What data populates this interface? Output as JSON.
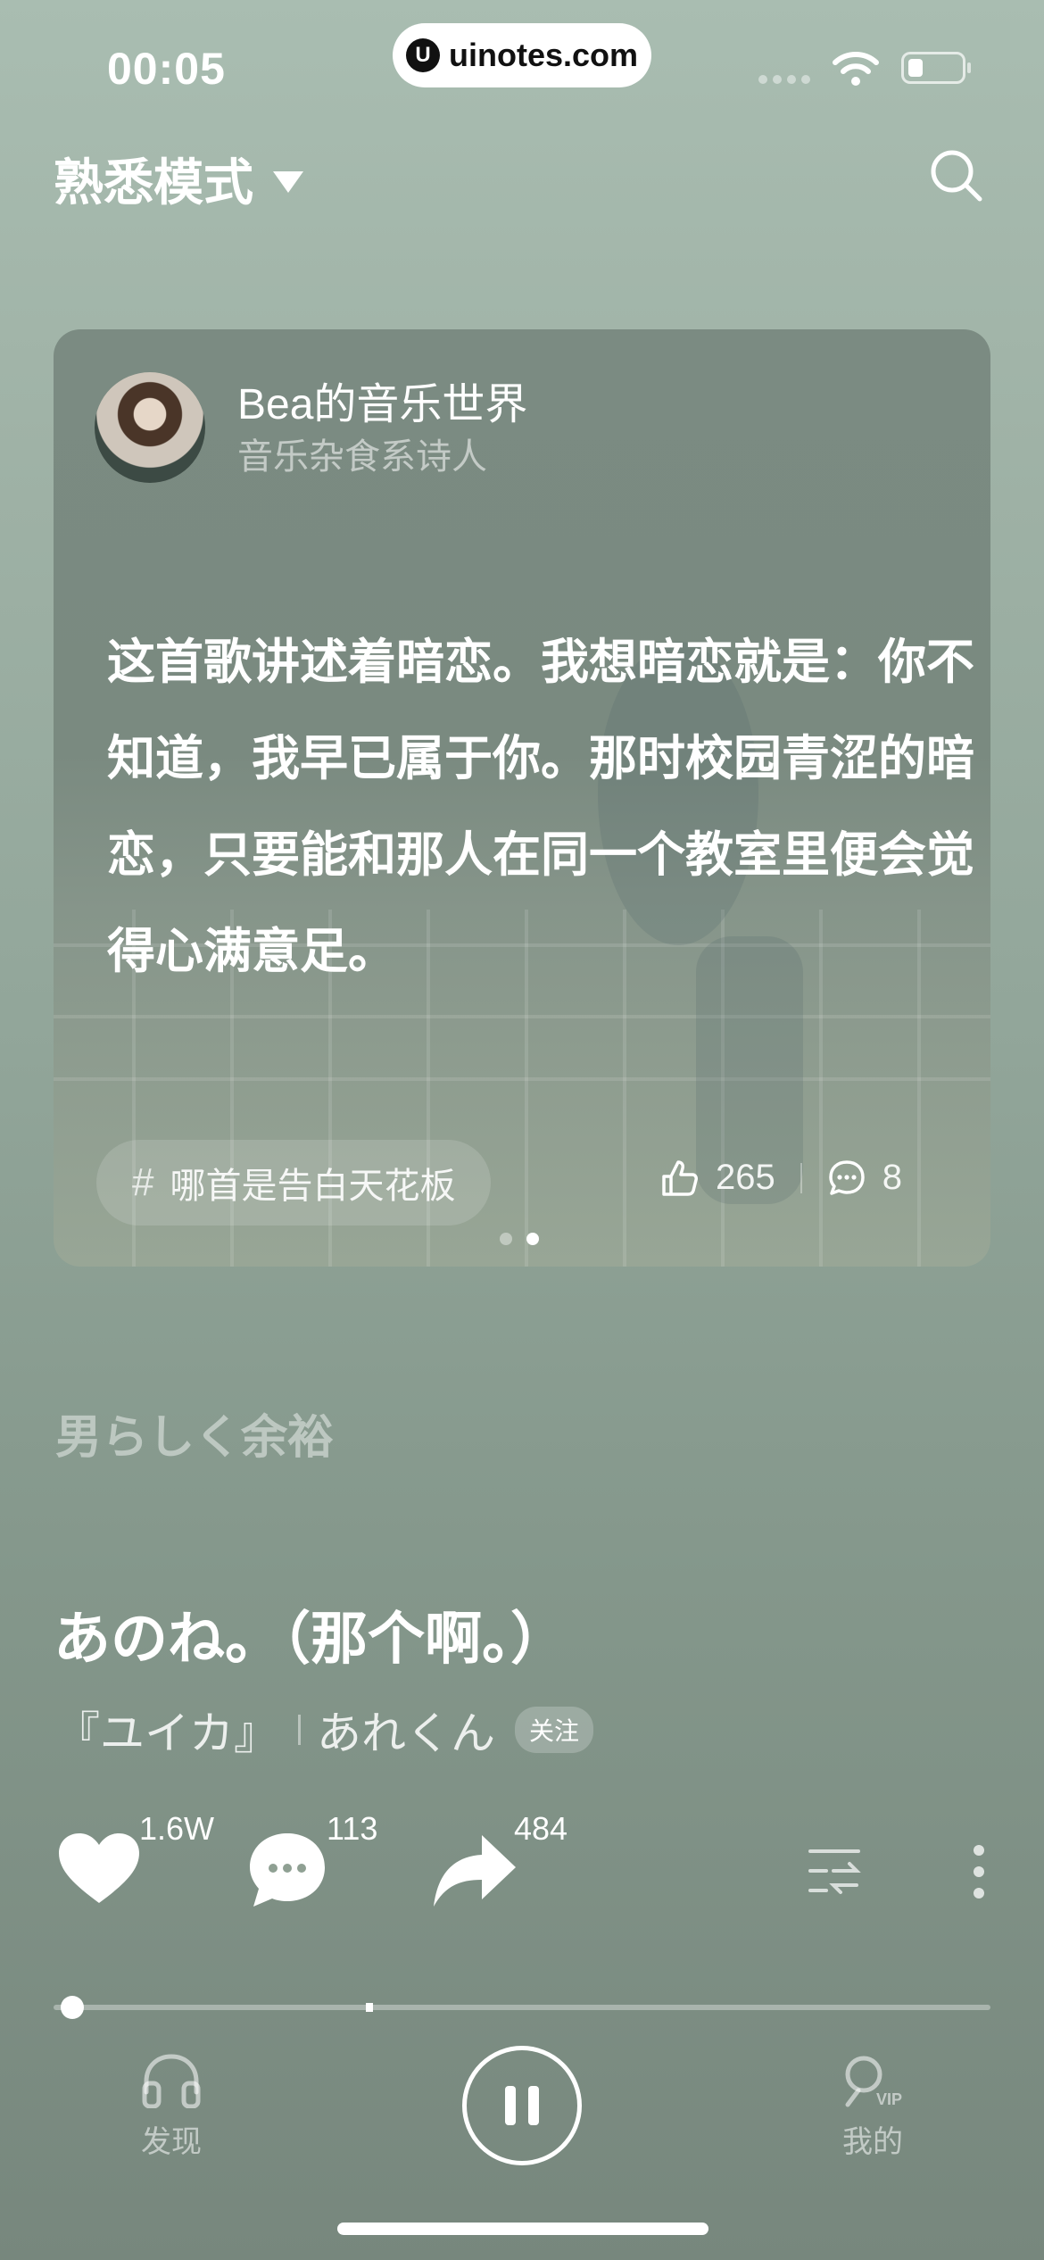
{
  "status_bar": {
    "time": "00:05",
    "watermark": "uinotes.com"
  },
  "header": {
    "mode_label": "熟悉模式",
    "icons": [
      "chevron-down-icon",
      "search-icon"
    ]
  },
  "card": {
    "author_name": "Bea的音乐世界",
    "author_subtitle": "音乐杂食系诗人",
    "quote": "这首歌讲述着暗恋。我想暗恋就是：你不知道，我早已属于你。那时校园青涩的暗恋，只要能和那人在同一个教室里便会觉得心满意足。",
    "tag": "哪首是告白天花板",
    "likes": "265",
    "comments": "8",
    "page_index": 2,
    "page_count": 2
  },
  "lyric_line": "男らしく余裕",
  "song": {
    "title": "あのね。（那个啊。）",
    "album": "『ユイカ』",
    "artist": "あれくん",
    "follow_label": "关注"
  },
  "actions": {
    "like_count": "1.6W",
    "comment_count": "113",
    "share_count": "484"
  },
  "progress": {
    "played_fraction": 0.02
  },
  "tab_bar": {
    "discover_label": "发现",
    "mine_label": "我的",
    "vip_badge": "VIP"
  },
  "colors": {
    "background_top": "#a9bdb1",
    "background_bottom": "#77877d",
    "card_bg": "#7b8b82"
  }
}
